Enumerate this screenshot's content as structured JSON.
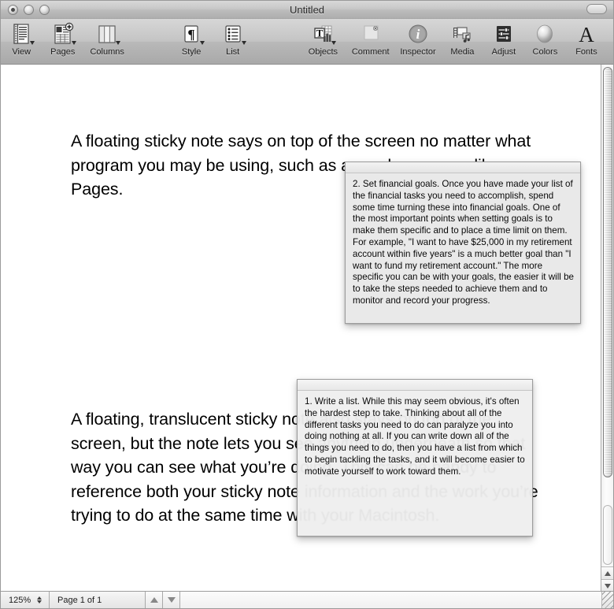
{
  "window": {
    "title": "Untitled",
    "buttons": {
      "close": "close",
      "minimize": "minimize",
      "zoom": "zoom"
    },
    "toolbar_toggle": "toolbar-toggle"
  },
  "toolbar": {
    "items": [
      {
        "label": "View",
        "icon": "view-icon",
        "has_menu": true
      },
      {
        "label": "Pages",
        "icon": "pages-icon",
        "has_menu": true
      },
      {
        "label": "Columns",
        "icon": "columns-icon",
        "has_menu": true
      },
      {
        "label": "Style",
        "icon": "style-icon",
        "has_menu": true
      },
      {
        "label": "List",
        "icon": "list-icon",
        "has_menu": true
      },
      {
        "label": "Objects",
        "icon": "objects-icon",
        "has_menu": true
      },
      {
        "label": "Comment",
        "icon": "comment-icon",
        "has_menu": false
      },
      {
        "label": "Inspector",
        "icon": "inspector-icon",
        "has_menu": false
      },
      {
        "label": "Media",
        "icon": "media-icon",
        "has_menu": false
      },
      {
        "label": "Adjust",
        "icon": "adjust-icon",
        "has_menu": false
      },
      {
        "label": "Colors",
        "icon": "colors-icon",
        "has_menu": false
      },
      {
        "label": "Fonts",
        "icon": "fonts-icon",
        "has_menu": false
      }
    ]
  },
  "document": {
    "paragraphs": [
      "A floating sticky note says on top of the screen no matter what program you may be using, such as a word processor like Pages.",
      "A floating, translucent sticky note also stays on top of the screen, but the note lets you see anything underneath so that way you can see what you’re doing. This can be handy to reference both your sticky note information and the work you’re trying to do at the same time with your Macintosh."
    ]
  },
  "notes": [
    {
      "id": "note-financial-goals",
      "translucent": false,
      "text": "2. Set financial goals. Once you have made your list of the financial tasks you need to accomplish, spend some time turning these into financial goals. One of the most important points when setting goals is to make them specific and to place a time limit on them. For example, \"I want to have $25,000 in my retirement account within five years\" is a much better goal than \"I want to fund my retirement account.\" The more specific you can be with your goals, the easier it will be to take the steps needed to achieve them and to monitor and record your progress."
    },
    {
      "id": "note-write-a-list",
      "translucent": true,
      "text": "1. Write a list. While this may seem obvious, it's often the hardest step to take. Thinking about all of the different tasks you need to do can paralyze you into doing nothing at all. If you can write down all of the things you need to do, then you have a list from which to begin tackling the tasks, and it will become easier to motivate yourself to work toward them."
    }
  ],
  "status_bar": {
    "zoom": "125%",
    "page_indicator": "Page 1 of 1",
    "prev_page": "previous-page",
    "next_page": "next-page"
  },
  "colors": {
    "toolbar_top": "#d7d7d7",
    "toolbar_bottom": "#a9a9a9",
    "note_bg": "#e9e9e9",
    "page_bg": "#ffffff",
    "text": "#000000",
    "muted_text": "#b3b3b3"
  }
}
